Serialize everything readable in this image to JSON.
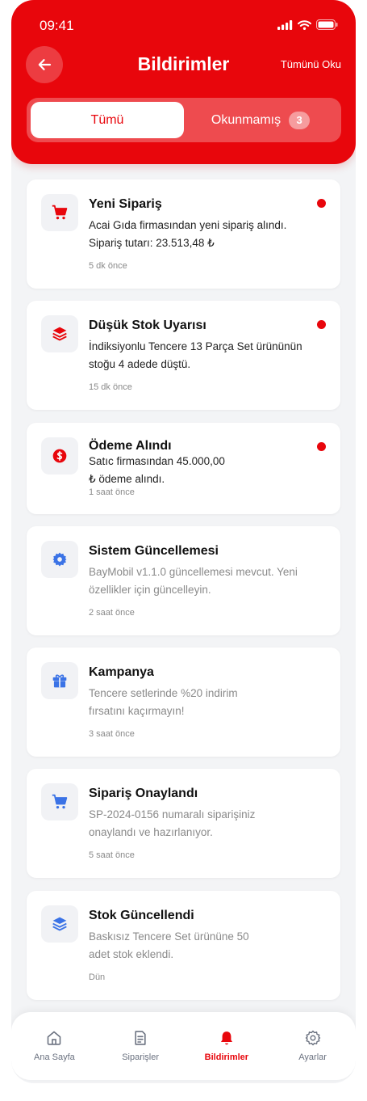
{
  "status": {
    "time": "09:41"
  },
  "header": {
    "title": "Bildirimler",
    "mark_all": "Tümünü Oku"
  },
  "segments": {
    "all": "Tümü",
    "unread": "Okunmamış",
    "unread_count": "3"
  },
  "colors": {
    "primary": "#e8060c",
    "unread_icon": "#e8060c",
    "read_icon": "#3b73e6"
  },
  "notifications": [
    {
      "icon": "cart-icon",
      "title": "Yeni Sipariş",
      "lines": [
        "Acai Gıda firmasından yeni sipariş alındı.",
        "Sipariş tutarı: 23.513,48 ₺"
      ],
      "time": "5 dk önce",
      "unread": true
    },
    {
      "icon": "layers-icon",
      "title": "Düşük Stok Uyarısı",
      "lines": [
        "İndiksiyonlu Tencere 13 Parça Set ürününün",
        "stoğu 4 adede düştü."
      ],
      "time": "15 dk önce",
      "unread": true
    },
    {
      "icon": "dollar-icon",
      "title": "Ödeme Alındı",
      "lines": [
        "Satıc firmasından 45.000,00",
        "₺ ödeme alındı."
      ],
      "time": "1 saat önce",
      "unread": true
    },
    {
      "icon": "gear-icon",
      "title": "Sistem Güncellemesi",
      "lines": [
        "BayMobil v1.1.0 güncellemesi mevcut. Yeni",
        "özellikler için güncelleyin."
      ],
      "time": "2 saat önce",
      "unread": false
    },
    {
      "icon": "gift-icon",
      "title": "Kampanya",
      "lines": [
        "Tencere setlerinde %20 indirim",
        "fırsatını kaçırmayın!"
      ],
      "time": "3 saat önce",
      "unread": false
    },
    {
      "icon": "cart-icon",
      "title": "Sipariş Onaylandı",
      "lines": [
        "SP-2024-0156 numaralı siparişiniz",
        "onaylandı ve hazırlanıyor."
      ],
      "time": "5 saat önce",
      "unread": false
    },
    {
      "icon": "layers-icon",
      "title": "Stok Güncellendi",
      "lines": [
        "Baskısız Tencere Set ürününe 50",
        "adet stok eklendi."
      ],
      "time": "Dün",
      "unread": false
    }
  ],
  "tabbar": [
    {
      "label": "Ana Sayfa",
      "icon": "home-icon",
      "active": false
    },
    {
      "label": "Siparişler",
      "icon": "orders-icon",
      "active": false
    },
    {
      "label": "Bildirimler",
      "icon": "bell-icon",
      "active": true
    },
    {
      "label": "Ayarlar",
      "icon": "gear-icon",
      "active": false
    }
  ]
}
